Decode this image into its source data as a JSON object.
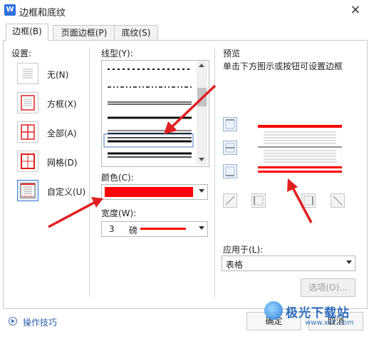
{
  "window": {
    "title": "边框和底纹",
    "icon": "wps-writer-icon",
    "close": "×"
  },
  "tabs": [
    {
      "label": "边框(B)",
      "active": true
    },
    {
      "label": "页面边框(P)",
      "active": false
    },
    {
      "label": "底纹(S)",
      "active": false
    }
  ],
  "settings": {
    "heading": "设置:",
    "items": [
      {
        "label": "无(N)",
        "icon": "border-none-icon"
      },
      {
        "label": "方框(X)",
        "icon": "border-box-icon"
      },
      {
        "label": "全部(A)",
        "icon": "border-all-icon"
      },
      {
        "label": "网格(D)",
        "icon": "border-grid-icon"
      },
      {
        "label": "自定义(U)",
        "icon": "border-custom-icon",
        "selected": true
      }
    ]
  },
  "line_style": {
    "label": "线型(Y):",
    "selected_index": 5
  },
  "color": {
    "label": "颜色(C):",
    "value": "#ff0000"
  },
  "width": {
    "label": "宽度(W):",
    "value": "3",
    "unit": "磅"
  },
  "preview": {
    "heading": "预览",
    "hint": "单击下方图示或按钮可设置边框",
    "border_color": "#ff0000"
  },
  "apply_to": {
    "label": "应用于(L):",
    "value": "表格"
  },
  "options_button": "选项(O)...",
  "tips_link": "操作技巧",
  "ok_button": "确定",
  "cancel_button": "取消",
  "watermark": {
    "text": "极光下载站",
    "url": "www.xz7.com"
  }
}
